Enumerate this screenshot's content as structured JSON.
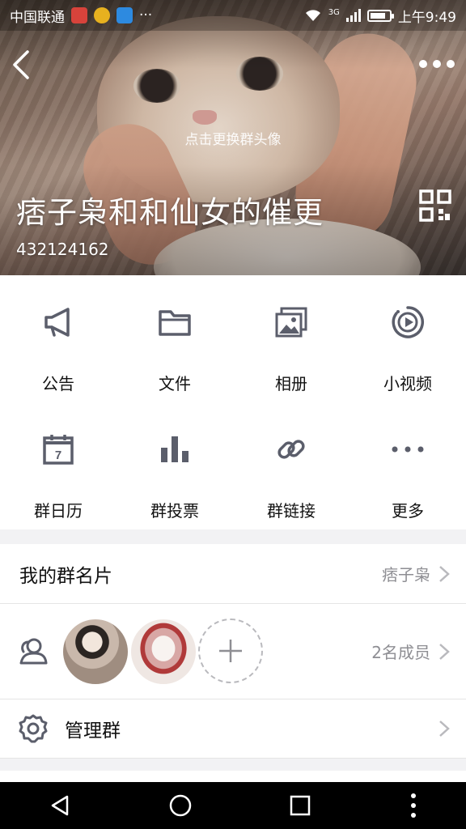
{
  "status_bar": {
    "carrier": "中国联通",
    "network": "3G",
    "time": "上午9:49"
  },
  "header": {
    "change_avatar_hint": "点击更换群头像",
    "group_name": "痞子枭和和仙女的催更",
    "group_id": "432124162"
  },
  "functions": [
    {
      "label": "公告",
      "icon": "megaphone-icon"
    },
    {
      "label": "文件",
      "icon": "folder-icon"
    },
    {
      "label": "相册",
      "icon": "album-icon"
    },
    {
      "label": "小视频",
      "icon": "video-icon"
    },
    {
      "label": "群日历",
      "icon": "calendar-icon",
      "calendar_day": "7"
    },
    {
      "label": "群投票",
      "icon": "bar-chart-icon"
    },
    {
      "label": "群链接",
      "icon": "link-icon"
    },
    {
      "label": "更多",
      "icon": "more-dots-icon"
    }
  ],
  "my_card": {
    "title": "我的群名片",
    "value": "痞子枭"
  },
  "members": {
    "count_label": "2名成员"
  },
  "manage": {
    "title": "管理群"
  },
  "colors": {
    "icon_gray": "#5b5e6b",
    "text": "#111111",
    "secondary_text": "#8e8e93",
    "background": "#f2f2f4"
  }
}
